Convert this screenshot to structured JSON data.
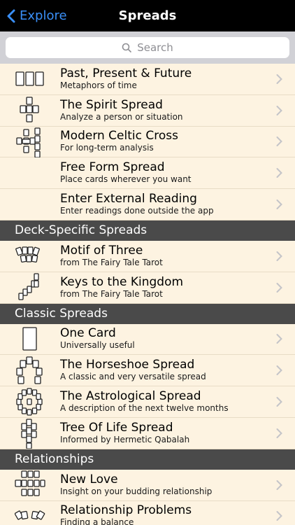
{
  "nav": {
    "back_label": "Explore",
    "title": "Spreads"
  },
  "search": {
    "placeholder": "Search"
  },
  "rows_top": [
    {
      "title": "Past, Present & Future",
      "subtitle": "Metaphors of time",
      "icon": "three-cards-icon"
    },
    {
      "title": "The Spirit Spread",
      "subtitle": "Analyze a person or situation",
      "icon": "spirit-spread-icon"
    },
    {
      "title": "Modern Celtic Cross",
      "subtitle": "For long-term analysis",
      "icon": "celtic-cross-icon"
    },
    {
      "title": "Free Form Spread",
      "subtitle": "Place cards wherever you want",
      "icon": ""
    },
    {
      "title": "Enter External Reading",
      "subtitle": "Enter readings done outside the app",
      "icon": ""
    }
  ],
  "sections": [
    {
      "header": "Deck-Specific Spreads",
      "rows": [
        {
          "title": "Motif of Three",
          "subtitle": "from The Fairy Tale Tarot",
          "icon": "motif-of-three-icon"
        },
        {
          "title": "Keys to the Kingdom",
          "subtitle": "from The Fairy Tale Tarot",
          "icon": "keys-kingdom-icon"
        }
      ]
    },
    {
      "header": "Classic Spreads",
      "rows": [
        {
          "title": "One Card",
          "subtitle": "Universally useful",
          "icon": "one-card-icon"
        },
        {
          "title": "The Horseshoe Spread",
          "subtitle": "A classic and very versatile spread",
          "icon": "horseshoe-icon"
        },
        {
          "title": "The Astrological Spread",
          "subtitle": "A description of the next twelve months",
          "icon": "astrological-icon"
        },
        {
          "title": "Tree Of Life Spread",
          "subtitle": "Informed by Hermetic Qabalah",
          "icon": "tree-of-life-icon"
        }
      ]
    },
    {
      "header": "Relationships",
      "rows": [
        {
          "title": "New Love",
          "subtitle": "Insight on your budding relationship",
          "icon": "new-love-icon"
        },
        {
          "title": "Relationship Problems",
          "subtitle": "Finding a balance",
          "icon": "relationship-problems-icon"
        }
      ]
    }
  ]
}
